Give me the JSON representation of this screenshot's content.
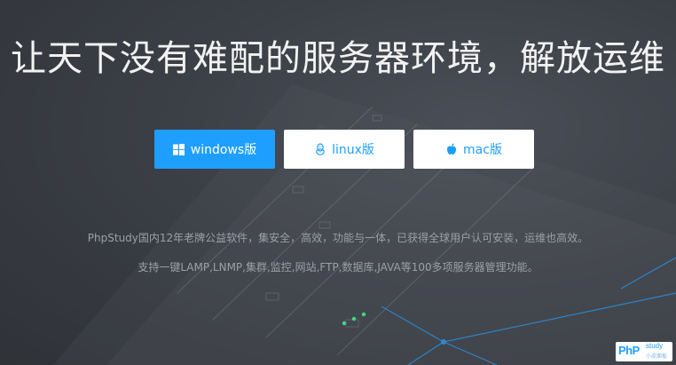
{
  "hero": {
    "headline": "让天下没有难配的服务器环境，解放运维",
    "buttons": {
      "windows": {
        "label": "windows版",
        "icon": "windows-icon"
      },
      "linux": {
        "label": "linux版",
        "icon": "linux-penguin-icon"
      },
      "mac": {
        "label": "mac版",
        "icon": "apple-icon"
      }
    },
    "description_line1": "PhpStudy国内12年老牌公益软件，集安全，高效，功能与一体，已获得全球用户认可安装，运维也高效。",
    "description_line2": "支持一键LAMP,LNMP,集群,监控,网站,FTP,数据库,JAVA等100多项服务器管理功能。"
  },
  "logo": {
    "main": "PhP",
    "sup": "study",
    "sub": "小皮面板"
  },
  "colors": {
    "primary": "#1e9fff",
    "background": "#3a3e44",
    "headline_text": "#f2f2f2",
    "description_text": "#9aa0a8"
  }
}
